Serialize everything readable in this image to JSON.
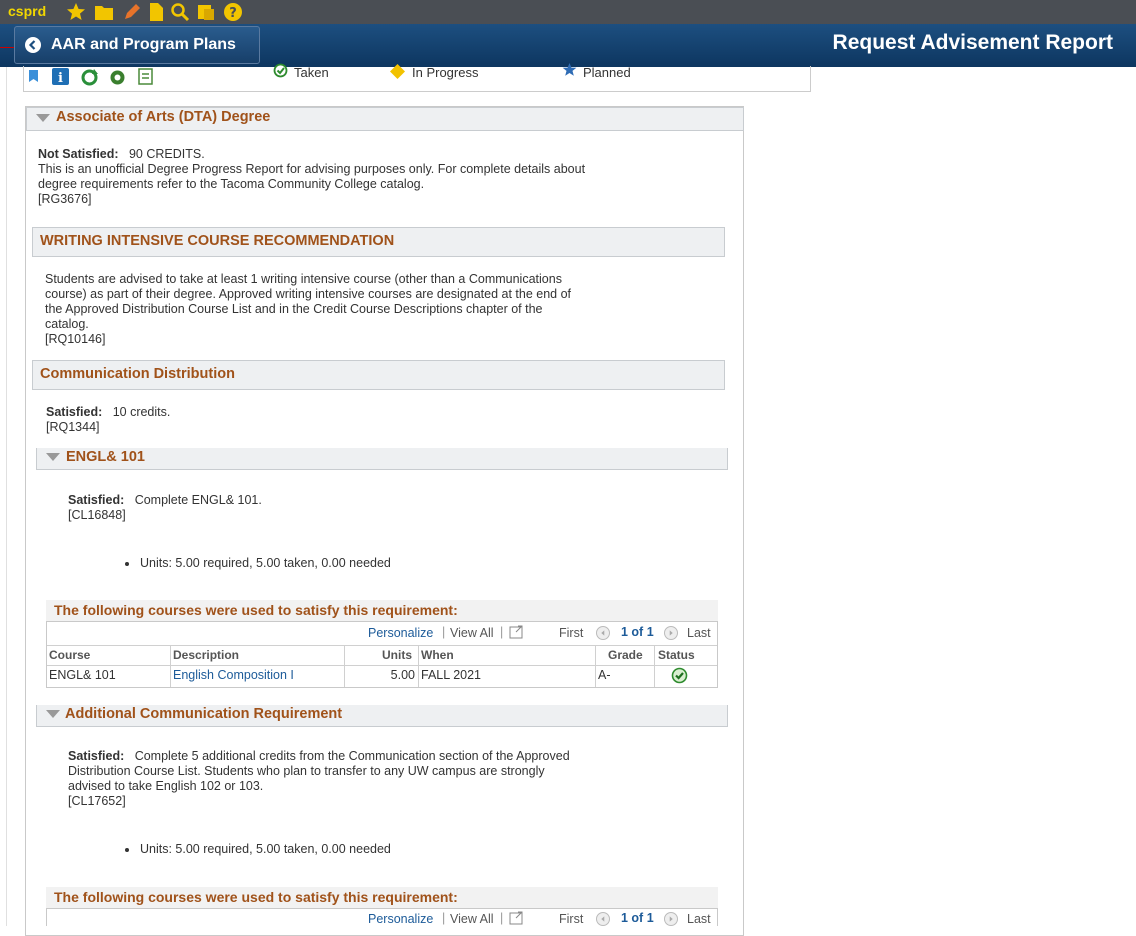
{
  "toolbar": {
    "app_name": "csprd",
    "icons": [
      "star-icon",
      "folder-icon",
      "pencil-icon",
      "document-icon",
      "search-icon",
      "notes-icon",
      "help-icon"
    ]
  },
  "header": {
    "back_label": "AAR and Program Plans",
    "title": "Request Advisement Report"
  },
  "legend": {
    "taken": "Taken",
    "in_progress": "In Progress",
    "planned": "Planned"
  },
  "degree": {
    "title": "Associate of Arts (DTA) Degree",
    "status_label": "Not Satisfied:",
    "status_value": "90 CREDITS.",
    "desc_line1": "This is an unofficial Degree Progress Report for advising purposes only. For complete details about",
    "desc_line2": "degree requirements refer to the Tacoma Community College catalog.",
    "code": "[RG3676]"
  },
  "writing": {
    "title": "WRITING INTENSIVE COURSE RECOMMENDATION",
    "line1": "Students are advised to take at least 1 writing intensive course (other than a Communications",
    "line2": "course) as part of their degree. Approved writing intensive courses are designated at the end of",
    "line3": "the Approved Distribution Course List and in the Credit Course Descriptions chapter of the",
    "line4": "catalog.",
    "code": "[RQ10146]"
  },
  "comm": {
    "title": "Communication Distribution",
    "status_label": "Satisfied:",
    "status_value": "10 credits.",
    "code": "[RQ1344]"
  },
  "engl": {
    "title": "ENGL& 101",
    "status_label": "Satisfied:",
    "status_value": "Complete ENGL& 101.",
    "code": "[CL16848]",
    "units": "Units: 5.00 required, 5.00 taken, 0.00 needed"
  },
  "grid1": {
    "title": "The following courses were used to satisfy this requirement:",
    "personalize": "Personalize",
    "view_all": "View All",
    "first": "First",
    "page": "1 of 1",
    "last": "Last",
    "columns": [
      "Course",
      "Description",
      "Units",
      "When",
      "Grade",
      "Status"
    ],
    "rows": [
      {
        "course": "ENGL& 101",
        "description": "English Composition I",
        "units": "5.00",
        "when": "FALL 2021",
        "grade": "A-",
        "status": "taken"
      }
    ]
  },
  "addl": {
    "title": "Additional Communication Requirement",
    "status_label": "Satisfied:",
    "line1": "Complete 5 additional credits from the Communication section of the Approved",
    "line2": "Distribution Course List. Students who plan to transfer to any UW campus are strongly",
    "line3": "advised to take English 102 or 103.",
    "code": "[CL17652]",
    "units": "Units: 5.00 required, 5.00 taken, 0.00 needed"
  },
  "grid2": {
    "title": "The following courses were used to satisfy this requirement:",
    "personalize": "Personalize",
    "view_all": "View All",
    "first": "First",
    "page": "1 of 1",
    "last": "Last"
  },
  "colors": {
    "header_bg": "#0d3660",
    "section_title": "#a0521a",
    "link": "#1d5b99",
    "taken_green": "#2e8b2e"
  }
}
